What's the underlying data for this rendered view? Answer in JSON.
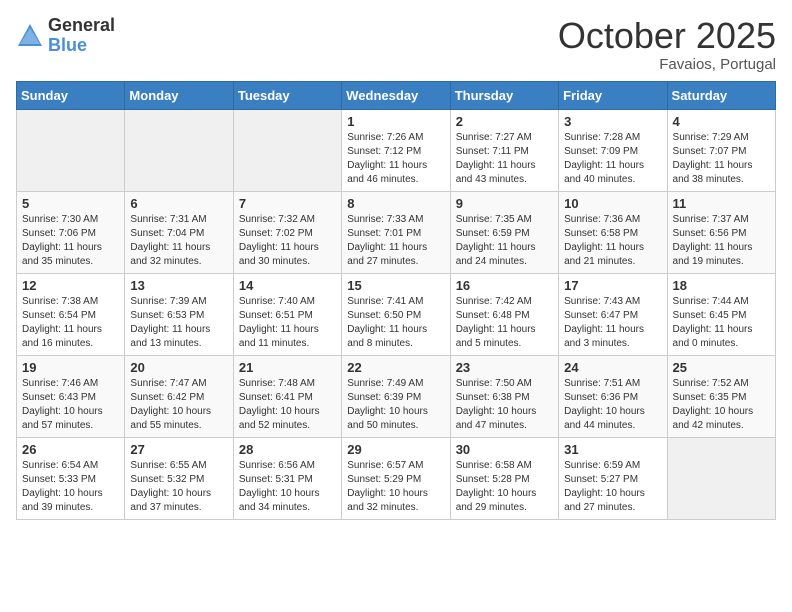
{
  "header": {
    "logo_general": "General",
    "logo_blue": "Blue",
    "month_title": "October 2025",
    "location": "Favaios, Portugal"
  },
  "days_of_week": [
    "Sunday",
    "Monday",
    "Tuesday",
    "Wednesday",
    "Thursday",
    "Friday",
    "Saturday"
  ],
  "weeks": [
    [
      {
        "day": "",
        "info": ""
      },
      {
        "day": "",
        "info": ""
      },
      {
        "day": "",
        "info": ""
      },
      {
        "day": "1",
        "info": "Sunrise: 7:26 AM\nSunset: 7:12 PM\nDaylight: 11 hours and 46 minutes."
      },
      {
        "day": "2",
        "info": "Sunrise: 7:27 AM\nSunset: 7:11 PM\nDaylight: 11 hours and 43 minutes."
      },
      {
        "day": "3",
        "info": "Sunrise: 7:28 AM\nSunset: 7:09 PM\nDaylight: 11 hours and 40 minutes."
      },
      {
        "day": "4",
        "info": "Sunrise: 7:29 AM\nSunset: 7:07 PM\nDaylight: 11 hours and 38 minutes."
      }
    ],
    [
      {
        "day": "5",
        "info": "Sunrise: 7:30 AM\nSunset: 7:06 PM\nDaylight: 11 hours and 35 minutes."
      },
      {
        "day": "6",
        "info": "Sunrise: 7:31 AM\nSunset: 7:04 PM\nDaylight: 11 hours and 32 minutes."
      },
      {
        "day": "7",
        "info": "Sunrise: 7:32 AM\nSunset: 7:02 PM\nDaylight: 11 hours and 30 minutes."
      },
      {
        "day": "8",
        "info": "Sunrise: 7:33 AM\nSunset: 7:01 PM\nDaylight: 11 hours and 27 minutes."
      },
      {
        "day": "9",
        "info": "Sunrise: 7:35 AM\nSunset: 6:59 PM\nDaylight: 11 hours and 24 minutes."
      },
      {
        "day": "10",
        "info": "Sunrise: 7:36 AM\nSunset: 6:58 PM\nDaylight: 11 hours and 21 minutes."
      },
      {
        "day": "11",
        "info": "Sunrise: 7:37 AM\nSunset: 6:56 PM\nDaylight: 11 hours and 19 minutes."
      }
    ],
    [
      {
        "day": "12",
        "info": "Sunrise: 7:38 AM\nSunset: 6:54 PM\nDaylight: 11 hours and 16 minutes."
      },
      {
        "day": "13",
        "info": "Sunrise: 7:39 AM\nSunset: 6:53 PM\nDaylight: 11 hours and 13 minutes."
      },
      {
        "day": "14",
        "info": "Sunrise: 7:40 AM\nSunset: 6:51 PM\nDaylight: 11 hours and 11 minutes."
      },
      {
        "day": "15",
        "info": "Sunrise: 7:41 AM\nSunset: 6:50 PM\nDaylight: 11 hours and 8 minutes."
      },
      {
        "day": "16",
        "info": "Sunrise: 7:42 AM\nSunset: 6:48 PM\nDaylight: 11 hours and 5 minutes."
      },
      {
        "day": "17",
        "info": "Sunrise: 7:43 AM\nSunset: 6:47 PM\nDaylight: 11 hours and 3 minutes."
      },
      {
        "day": "18",
        "info": "Sunrise: 7:44 AM\nSunset: 6:45 PM\nDaylight: 11 hours and 0 minutes."
      }
    ],
    [
      {
        "day": "19",
        "info": "Sunrise: 7:46 AM\nSunset: 6:43 PM\nDaylight: 10 hours and 57 minutes."
      },
      {
        "day": "20",
        "info": "Sunrise: 7:47 AM\nSunset: 6:42 PM\nDaylight: 10 hours and 55 minutes."
      },
      {
        "day": "21",
        "info": "Sunrise: 7:48 AM\nSunset: 6:41 PM\nDaylight: 10 hours and 52 minutes."
      },
      {
        "day": "22",
        "info": "Sunrise: 7:49 AM\nSunset: 6:39 PM\nDaylight: 10 hours and 50 minutes."
      },
      {
        "day": "23",
        "info": "Sunrise: 7:50 AM\nSunset: 6:38 PM\nDaylight: 10 hours and 47 minutes."
      },
      {
        "day": "24",
        "info": "Sunrise: 7:51 AM\nSunset: 6:36 PM\nDaylight: 10 hours and 44 minutes."
      },
      {
        "day": "25",
        "info": "Sunrise: 7:52 AM\nSunset: 6:35 PM\nDaylight: 10 hours and 42 minutes."
      }
    ],
    [
      {
        "day": "26",
        "info": "Sunrise: 6:54 AM\nSunset: 5:33 PM\nDaylight: 10 hours and 39 minutes."
      },
      {
        "day": "27",
        "info": "Sunrise: 6:55 AM\nSunset: 5:32 PM\nDaylight: 10 hours and 37 minutes."
      },
      {
        "day": "28",
        "info": "Sunrise: 6:56 AM\nSunset: 5:31 PM\nDaylight: 10 hours and 34 minutes."
      },
      {
        "day": "29",
        "info": "Sunrise: 6:57 AM\nSunset: 5:29 PM\nDaylight: 10 hours and 32 minutes."
      },
      {
        "day": "30",
        "info": "Sunrise: 6:58 AM\nSunset: 5:28 PM\nDaylight: 10 hours and 29 minutes."
      },
      {
        "day": "31",
        "info": "Sunrise: 6:59 AM\nSunset: 5:27 PM\nDaylight: 10 hours and 27 minutes."
      },
      {
        "day": "",
        "info": ""
      }
    ]
  ]
}
